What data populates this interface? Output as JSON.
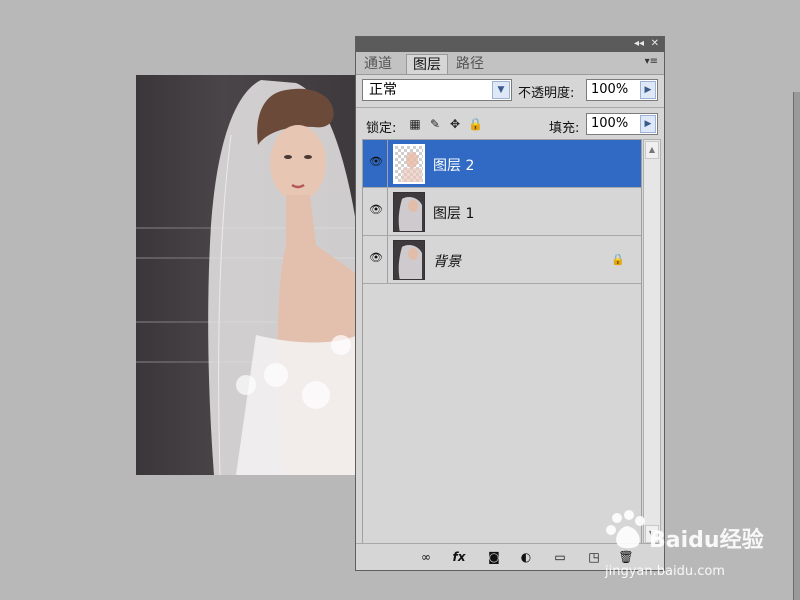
{
  "panel": {
    "tabs": [
      {
        "label": "通道",
        "active": false
      },
      {
        "label": "图层",
        "active": true
      },
      {
        "label": "路径",
        "active": false
      }
    ],
    "titlebar": {
      "collapse_glyph": "◂◂",
      "close_glyph": "✕"
    },
    "tab_menu_glyph": "▾≡",
    "blend_mode": "正常",
    "opacity_label": "不透明度:",
    "opacity_value": "100%",
    "lock_label": "锁定:",
    "fill_label": "填充:",
    "fill_value": "100%",
    "layers": [
      {
        "name": "图层 2",
        "visible": true,
        "selected": true,
        "locked": false
      },
      {
        "name": "图层 1",
        "visible": true,
        "selected": false,
        "locked": false
      },
      {
        "name": "背景",
        "visible": true,
        "selected": false,
        "locked": true
      }
    ],
    "bottom_icons": [
      "link-icon",
      "fx-icon",
      "mask-icon",
      "adjustment-icon",
      "group-folder-icon",
      "new-layer-icon",
      "trash-icon"
    ]
  },
  "watermark": {
    "brand": "Baidu经验",
    "url": "jingyan.baidu.com"
  },
  "colors": {
    "selection": "#316ac5",
    "panel_bg": "#d6d6d6",
    "workspace_bg": "#b8b8b8"
  }
}
